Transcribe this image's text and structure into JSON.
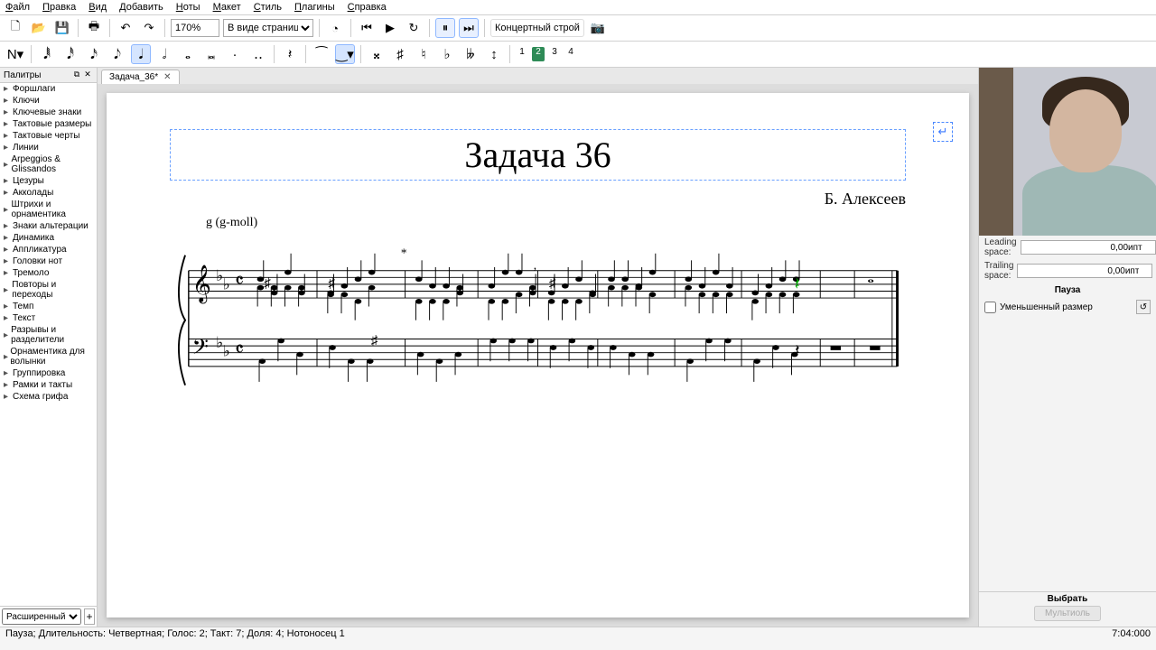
{
  "menu": [
    "Файл",
    "Правка",
    "Вид",
    "Добавить",
    "Ноты",
    "Макет",
    "Стиль",
    "Плагины",
    "Справка"
  ],
  "toolbar1": {
    "zoom": "170%",
    "view_mode": "В виде страниц",
    "pitch_label": "Концертный строй"
  },
  "toolbar2": {
    "voices": [
      "1",
      "2",
      "3",
      "4"
    ],
    "active_voice": 1
  },
  "palettes": {
    "title": "Палитры",
    "items": [
      "Форшлаги",
      "Ключи",
      "Ключевые знаки",
      "Тактовые размеры",
      "Тактовые черты",
      "Линии",
      "Arpeggios & Glissandos",
      "Цезуры",
      "Акколады",
      "Штрихи и орнаментика",
      "Знаки альтерации",
      "Динамика",
      "Аппликатура",
      "Головки нот",
      "Тремоло",
      "Повторы и переходы",
      "Темп",
      "Текст",
      "Разрывы и разделители",
      "Орнаментика для волынки",
      "Группировка",
      "Рамки и такты",
      "Схема грифа"
    ],
    "footer_mode": "Расширенный"
  },
  "tab": {
    "label": "Задача_36*"
  },
  "score": {
    "title": "Задача 36",
    "composer": "Б. Алексеев",
    "key_annotation": "g (g-moll)"
  },
  "inspector": {
    "leading_label": "Leading space:",
    "leading_value": "0,00ипт",
    "trailing_label": "Trailing space:",
    "trailing_value": "0,00ипт",
    "section": "Пауза",
    "small_label": "Уменьшенный размер",
    "select_label": "Выбрать",
    "multisel_btn": "Мультиоль"
  },
  "status": {
    "left": "Пауза; Длительность: Четвертная; Голос: 2; Такт: 7; Доля: 4; Нотоносец 1",
    "right": "7:04:000"
  }
}
